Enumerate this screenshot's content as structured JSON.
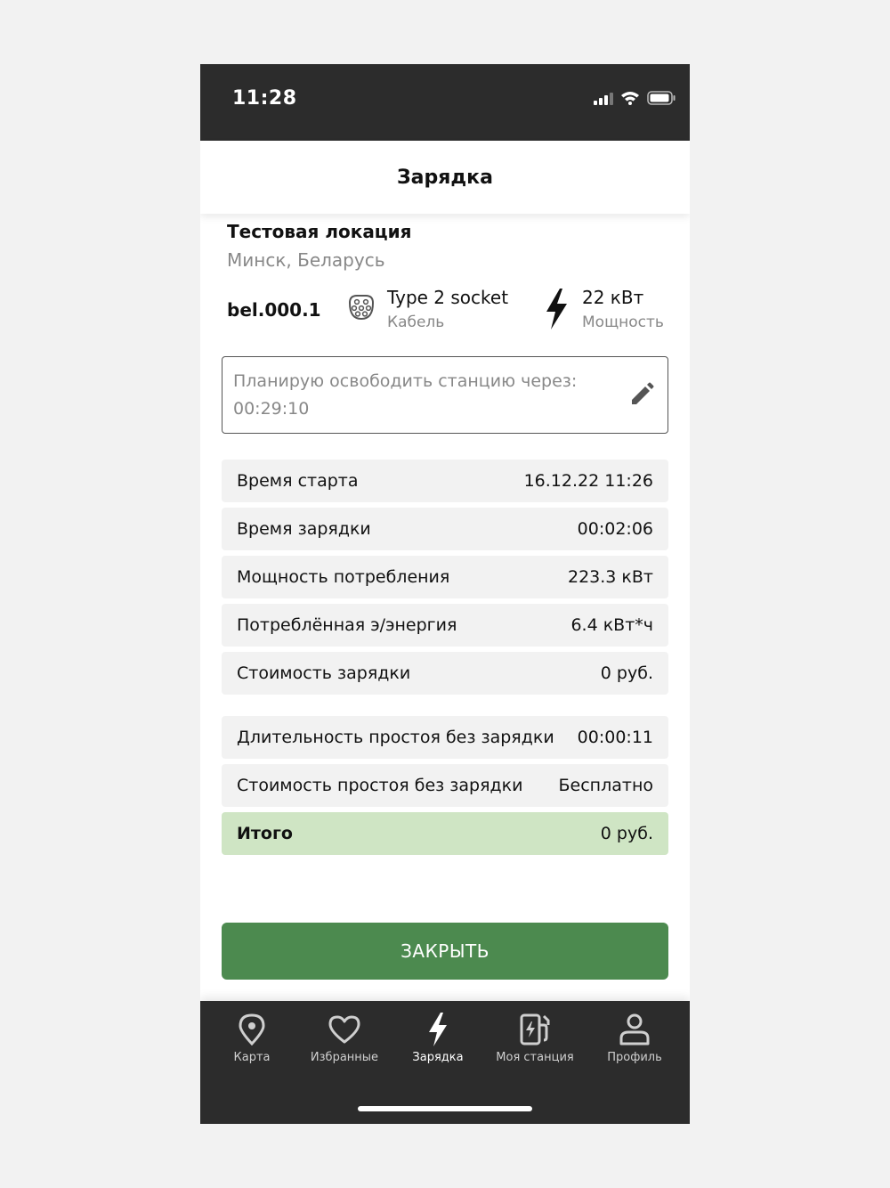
{
  "status": {
    "time": "11:28"
  },
  "header": {
    "title": "Зарядка"
  },
  "location": {
    "name": "Тестовая локация",
    "city": "Минск, Беларусь"
  },
  "station": {
    "id": "bel.000.1",
    "connector_name": "Type 2 socket",
    "connector_type": "Кабель",
    "power_value": "22 кВт",
    "power_label": "Мощность"
  },
  "release": {
    "label": "Планирую освободить станцию через:",
    "time": "00:29:10"
  },
  "session_rows": [
    {
      "label": "Время старта",
      "value": "16.12.22 11:26"
    },
    {
      "label": "Время зарядки",
      "value": "00:02:06"
    },
    {
      "label": "Мощность потребления",
      "value": "223.3 кВт"
    },
    {
      "label": "Потреблённая э/энергия",
      "value": "6.4 кВт*ч"
    },
    {
      "label": "Стоимость зарядки",
      "value": "0 руб."
    }
  ],
  "idle_rows": [
    {
      "label": "Длительность простоя без зарядки",
      "value": "00:00:11"
    },
    {
      "label": "Стоимость простоя без зарядки",
      "value": "Бесплатно"
    }
  ],
  "total": {
    "label": "Итого",
    "value": "0 руб."
  },
  "close_button": "ЗАКРЫТЬ",
  "tabs": [
    {
      "label": "Карта",
      "icon": "map-pin-icon"
    },
    {
      "label": "Избранные",
      "icon": "heart-icon"
    },
    {
      "label": "Зарядка",
      "icon": "bolt-icon",
      "active": true
    },
    {
      "label": "Моя станция",
      "icon": "charging-station-icon"
    },
    {
      "label": "Профиль",
      "icon": "user-icon"
    }
  ],
  "colors": {
    "dark_bar": "#2c2c2c",
    "accent_green": "#4c8a4f",
    "total_bg": "#cfe5c4",
    "row_bg": "#f2f2f2"
  }
}
